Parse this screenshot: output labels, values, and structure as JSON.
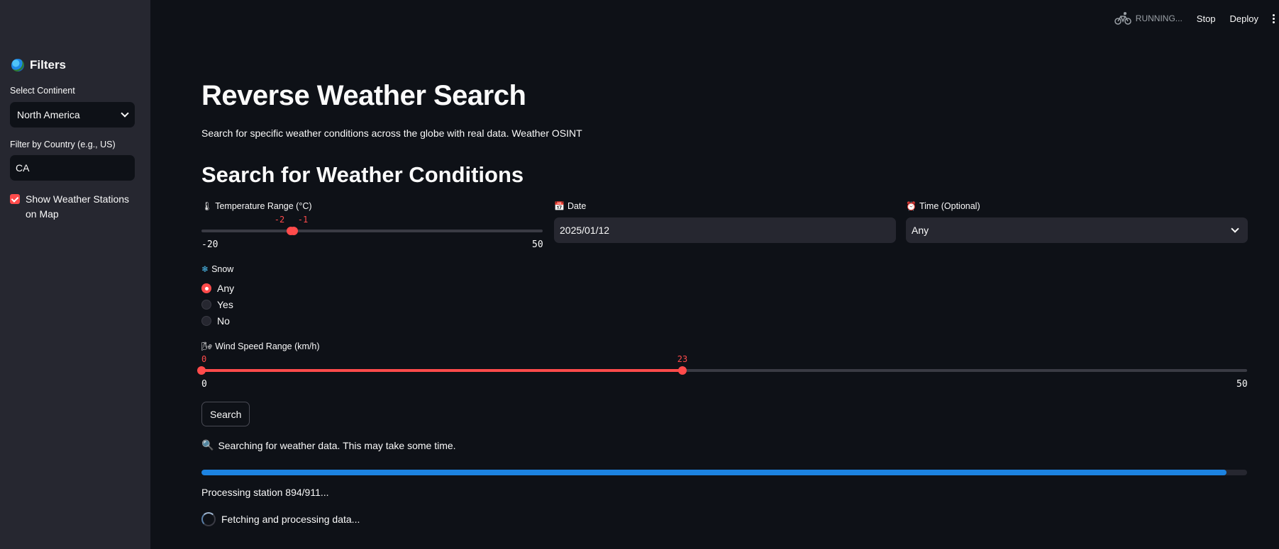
{
  "sidebar": {
    "title": "Filters",
    "continent_label": "Select Continent",
    "continent_value": "North America",
    "country_label": "Filter by Country (e.g., US)",
    "country_value": "CA",
    "show_stations_label": "Show Weather Stations on Map",
    "show_stations_checked": true
  },
  "header": {
    "status": "RUNNING...",
    "stop": "Stop",
    "deploy": "Deploy"
  },
  "main": {
    "title": "Reverse Weather Search",
    "subtitle": "Search for specific weather conditions across the globe with real data. Weather OSINT",
    "section_title": "Search for Weather Conditions",
    "temperature": {
      "label": "Temperature Range (°C)",
      "icon": "🌡",
      "min": "-20",
      "max": "50",
      "low": "-2",
      "high": "-1"
    },
    "date": {
      "label": "Date",
      "icon": "📅",
      "value": "2025/01/12"
    },
    "time": {
      "label": "Time (Optional)",
      "icon": "⏰",
      "value": "Any"
    },
    "snow": {
      "label": "Snow",
      "icon": "❄",
      "options": [
        "Any",
        "Yes",
        "No"
      ],
      "selected": "Any"
    },
    "wind": {
      "label": "Wind Speed Range (km/h)",
      "icon": "🌬",
      "min": "0",
      "max": "50",
      "low": "0",
      "high": "23"
    },
    "search_button": "Search",
    "info_icon": "🔍",
    "info_text": "Searching for weather data. This may take some time.",
    "progress": 0.98,
    "processing_text": "Processing station 894/911...",
    "fetching_text": "Fetching and processing data..."
  },
  "colors": {
    "accent": "#ff4b4b",
    "progress": "#1c83e1",
    "background": "#0e1117",
    "sidebar": "#262730"
  }
}
